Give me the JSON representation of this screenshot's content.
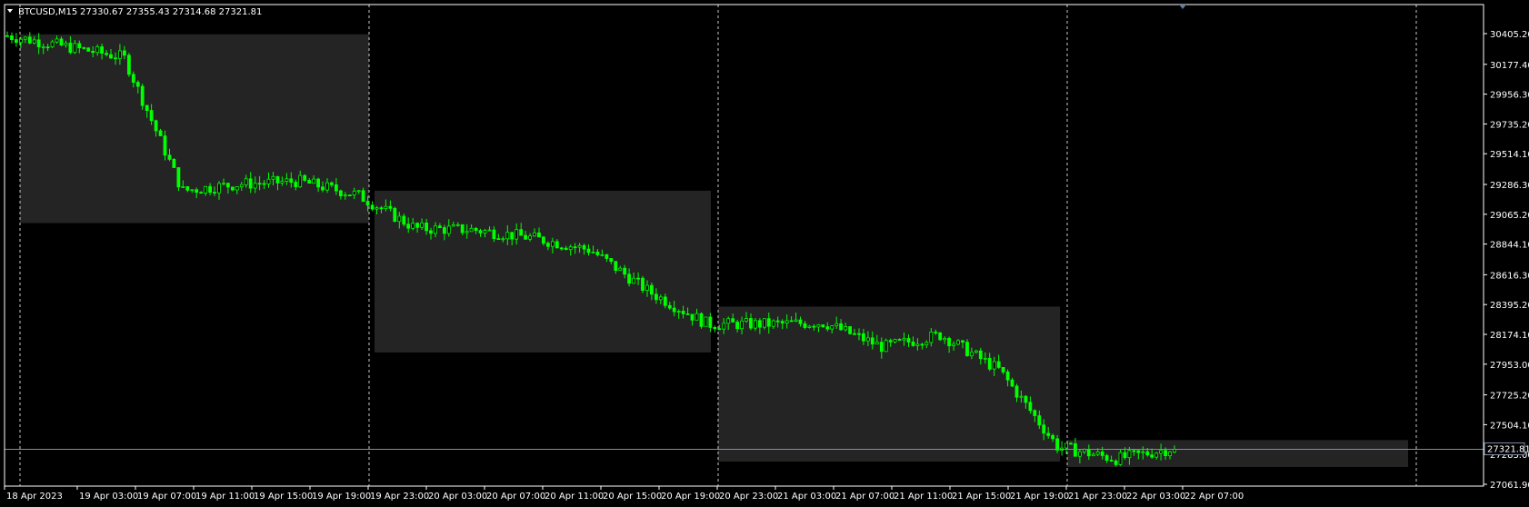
{
  "header": {
    "symbol_timeframe": "BTCUSD,M15",
    "ohlc": "27330.67 27355.43 27314.68 27321.81"
  },
  "colors": {
    "background": "#000000",
    "candle": "#00ff00",
    "session_box": "#242424",
    "separator": "#c8c8c8",
    "bid_line": "#7f8fa6",
    "axis_text": "#ffffff"
  },
  "price_axis": {
    "ticks": [
      "30405.20",
      "30177.40",
      "29956.30",
      "29735.20",
      "29514.10",
      "29286.30",
      "29065.20",
      "28844.10",
      "28616.30",
      "28395.20",
      "28174.10",
      "27953.00",
      "27725.20",
      "27504.10",
      "27283.00",
      "27061.90"
    ],
    "current_price_label": "27321.81"
  },
  "time_axis": {
    "ticks": [
      "18 Apr 2023",
      "19 Apr 03:00",
      "19 Apr 07:00",
      "19 Apr 11:00",
      "19 Apr 15:00",
      "19 Apr 19:00",
      "19 Apr 23:00",
      "20 Apr 03:00",
      "20 Apr 07:00",
      "20 Apr 11:00",
      "20 Apr 15:00",
      "20 Apr 19:00",
      "20 Apr 23:00",
      "21 Apr 03:00",
      "21 Apr 07:00",
      "21 Apr 11:00",
      "21 Apr 15:00",
      "21 Apr 19:00",
      "21 Apr 23:00",
      "22 Apr 03:00",
      "22 Apr 07:00"
    ]
  },
  "chart_data": {
    "type": "line",
    "series": [
      {
        "name": "BTCUSD",
        "x": [
          "18 Apr 2023",
          "19 Apr 03:00",
          "19 Apr 07:00",
          "19 Apr 11:00",
          "19 Apr 15:00",
          "19 Apr 19:00",
          "19 Apr 23:00",
          "20 Apr 03:00",
          "20 Apr 07:00",
          "20 Apr 11:00",
          "20 Apr 15:00",
          "20 Apr 19:00",
          "20 Apr 23:00",
          "21 Apr 03:00",
          "21 Apr 07:00",
          "21 Apr 11:00",
          "21 Apr 15:00",
          "21 Apr 19:00",
          "21 Apr 23:00",
          "22 Apr 03:00",
          "22 Apr 07:00"
        ],
        "values": [
          30390,
          30310,
          30230,
          29240,
          29290,
          29310,
          29210,
          28960,
          28950,
          28890,
          28800,
          28490,
          28250,
          28250,
          28260,
          28080,
          28170,
          27910,
          27340,
          27250,
          27330
        ]
      }
    ],
    "ylim": [
      27061.9,
      30405.2
    ],
    "grid": false,
    "session_ranges": [
      {
        "session": "19 Apr",
        "high": 30400,
        "low": 29000
      },
      {
        "session": "20 Apr",
        "high": 29240,
        "low": 28040
      },
      {
        "session": "21 Apr",
        "high": 28380,
        "low": 27230
      },
      {
        "session": "22 Apr",
        "high": 27390,
        "low": 27190
      }
    ]
  }
}
